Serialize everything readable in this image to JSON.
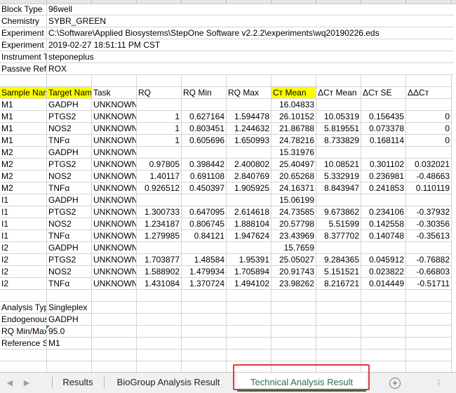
{
  "meta_rows": [
    {
      "label": "Block Type",
      "value": "96well"
    },
    {
      "label": "Chemistry",
      "value": "SYBR_GREEN"
    },
    {
      "label": "Experiment File Name",
      "value": "C:\\Software\\Applied Biosystems\\StepOne Software v2.2.2\\experiments\\wq20190226.eds"
    },
    {
      "label": "Experiment Run End Time",
      "value": "2019-02-27 18:51:11 PM CST"
    },
    {
      "label": "Instrument Type",
      "value": "steponeplus"
    },
    {
      "label": "Passive Reference",
      "value": "ROX"
    }
  ],
  "headers": [
    "Sample Name",
    "Target Name",
    "Task",
    "RQ",
    "RQ Min",
    "RQ Max",
    "Cт Mean",
    "ΔCт Mean",
    "ΔCт SE",
    "ΔΔCт"
  ],
  "rows": [
    [
      "M1",
      "GADPH",
      "UNKNOWN",
      "",
      "",
      "",
      "16.04833",
      "",
      "",
      ""
    ],
    [
      "M1",
      "PTGS2",
      "UNKNOWN",
      "1",
      "0.627164",
      "1.594478",
      "26.10152",
      "10.05319",
      "0.156435",
      "0"
    ],
    [
      "M1",
      "NOS2",
      "UNKNOWN",
      "1",
      "0.803451",
      "1.244632",
      "21.86788",
      "5.819551",
      "0.073378",
      "0"
    ],
    [
      "M1",
      "TNFα",
      "UNKNOWN",
      "1",
      "0.605696",
      "1.650993",
      "24.78216",
      "8.733829",
      "0.168114",
      "0"
    ],
    [
      "M2",
      "GADPH",
      "UNKNOWN",
      "",
      "",
      "",
      "15.31976",
      "",
      "",
      ""
    ],
    [
      "M2",
      "PTGS2",
      "UNKNOWN",
      "0.97805",
      "0.398442",
      "2.400802",
      "25.40497",
      "10.08521",
      "0.301102",
      "0.032021"
    ],
    [
      "M2",
      "NOS2",
      "UNKNOWN",
      "1.40117",
      "0.691108",
      "2.840769",
      "20.65268",
      "5.332919",
      "0.236981",
      "-0.48663"
    ],
    [
      "M2",
      "TNFα",
      "UNKNOWN",
      "0.926512",
      "0.450397",
      "1.905925",
      "24.16371",
      "8.843947",
      "0.241853",
      "0.110119"
    ],
    [
      "I1",
      "GADPH",
      "UNKNOWN",
      "",
      "",
      "",
      "15.06199",
      "",
      "",
      ""
    ],
    [
      "I1",
      "PTGS2",
      "UNKNOWN",
      "1.300733",
      "0.647095",
      "2.614618",
      "24.73585",
      "9.673862",
      "0.234106",
      "-0.37932"
    ],
    [
      "I1",
      "NOS2",
      "UNKNOWN",
      "1.234187",
      "0.806745",
      "1.888104",
      "20.57798",
      "5.51599",
      "0.142558",
      "-0.30356"
    ],
    [
      "I1",
      "TNFα",
      "UNKNOWN",
      "1.279985",
      "0.84121",
      "1.947624",
      "23.43969",
      "8.377702",
      "0.140748",
      "-0.35613"
    ],
    [
      "I2",
      "GADPH",
      "UNKNOWN",
      "",
      "",
      "",
      "15.7659",
      "",
      "",
      ""
    ],
    [
      "I2",
      "PTGS2",
      "UNKNOWN",
      "1.703877",
      "1.48584",
      "1.95391",
      "25.05027",
      "9.284365",
      "0.045912",
      "-0.76882"
    ],
    [
      "I2",
      "NOS2",
      "UNKNOWN",
      "1.588902",
      "1.479934",
      "1.705894",
      "20.91743",
      "5.151521",
      "0.023822",
      "-0.66803"
    ],
    [
      "I2",
      "TNFα",
      "UNKNOWN",
      "1.431084",
      "1.370724",
      "1.494102",
      "23.98262",
      "8.216721",
      "0.014449",
      "-0.51711"
    ]
  ],
  "footer_rows": [
    {
      "label": "Analysis Type",
      "value": "Singleplex"
    },
    {
      "label": "Endogenous Control",
      "value": "GADPH"
    },
    {
      "label": "RQ Min/Max Confidence",
      "value": "95.0"
    },
    {
      "label": "Reference Sample",
      "value": "M1"
    }
  ],
  "tabs": [
    {
      "label": "Results",
      "active": false
    },
    {
      "label": "BioGroup Analysis Result",
      "active": false
    },
    {
      "label": "Technical Analysis Result",
      "active": true
    }
  ],
  "nav": {
    "prev": "◀",
    "next": "▶",
    "add": "+",
    "more": "⋮"
  },
  "colors": {
    "highlight": "#ffff00",
    "active_tab": "#217346",
    "annotation_box": "#e03a3a"
  }
}
